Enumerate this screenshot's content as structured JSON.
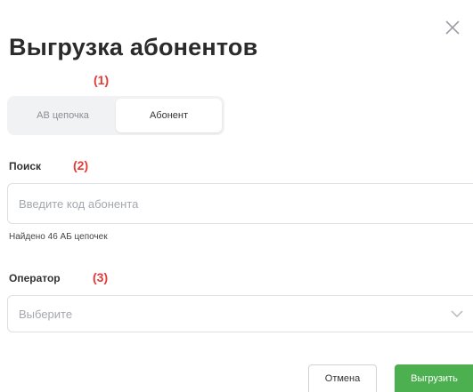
{
  "dialog": {
    "title": "Выгрузка абонентов"
  },
  "annotations": {
    "marker_1": "(1)",
    "marker_2": "(2)",
    "marker_3": "(3)",
    "color": "#e53935"
  },
  "mode_switch": {
    "options": [
      {
        "label": "АВ цепочка",
        "active": false
      },
      {
        "label": "Абонент",
        "active": true
      }
    ]
  },
  "search": {
    "label": "Поиск",
    "placeholder": "Введите код абонента",
    "value": "",
    "result_text": "Найдено 46 АБ цепочек"
  },
  "operator": {
    "label": "Оператор",
    "placeholder": "Выберите",
    "icon": "chevron-down-icon"
  },
  "footer": {
    "cancel_label": "Отмена",
    "export_label": "Выгрузить",
    "accent_color": "#4caf50"
  },
  "icons": {
    "close": "close-icon"
  }
}
